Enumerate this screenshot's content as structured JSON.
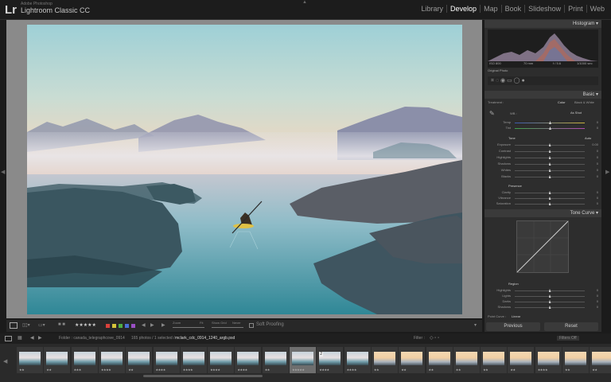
{
  "app": {
    "logo": "Lr",
    "vendor": "Adobe Photoshop",
    "product": "Lightroom Classic CC"
  },
  "modules": [
    "Library",
    "Develop",
    "Map",
    "Book",
    "Slideshow",
    "Print",
    "Web"
  ],
  "active_module": "Develop",
  "toolbar": {
    "zoom_label": "Zoom",
    "zoom_value": "Fit",
    "show_grid_label": "Show Grid",
    "show_grid_value": "Never",
    "soft_proofing": "Soft Proofing",
    "stars": "★★★★★"
  },
  "histogram": {
    "title": "Histogram",
    "iso": "ISO 800",
    "focal": "70 mm",
    "aperture": "f / 5.6",
    "shutter": "1/1000 sec",
    "original_label": "Original Photo"
  },
  "basic": {
    "title": "Basic",
    "treatment_label": "Treatment :",
    "color": "Color",
    "bw": "Black & White",
    "wb_label": "WB :",
    "wb_value": "As Shot",
    "temp": {
      "label": "Temp",
      "value": "0",
      "pos": 0.5
    },
    "tint": {
      "label": "Tint",
      "value": "0",
      "pos": 0.5
    },
    "tone_label": "Tone",
    "auto": "Auto",
    "tone": [
      {
        "label": "Exposure",
        "value": "0.00",
        "pos": 0.5
      },
      {
        "label": "Contrast",
        "value": "0",
        "pos": 0.5
      },
      {
        "label": "Highlights",
        "value": "0",
        "pos": 0.5
      },
      {
        "label": "Shadows",
        "value": "0",
        "pos": 0.5
      },
      {
        "label": "Whites",
        "value": "0",
        "pos": 0.5
      },
      {
        "label": "Blacks",
        "value": "0",
        "pos": 0.5
      }
    ],
    "presence_label": "Presence",
    "presence": [
      {
        "label": "Clarity",
        "value": "0",
        "pos": 0.5
      },
      {
        "label": "Vibrance",
        "value": "0",
        "pos": 0.5
      },
      {
        "label": "Saturation",
        "value": "0",
        "pos": 0.5
      }
    ]
  },
  "tone_curve": {
    "title": "Tone Curve",
    "region_label": "Region",
    "region": [
      {
        "label": "Highlights",
        "value": "0",
        "pos": 0.5
      },
      {
        "label": "Lights",
        "value": "0",
        "pos": 0.5
      },
      {
        "label": "Darks",
        "value": "0",
        "pos": 0.5
      },
      {
        "label": "Shadows",
        "value": "0",
        "pos": 0.5
      }
    ],
    "point_curve_label": "Point Curve :",
    "point_curve_value": "Linear"
  },
  "buttons": {
    "previous": "Previous",
    "reset": "Reset"
  },
  "filmstrip_bar": {
    "folder": "Folder : canada_telegraphcove_0914",
    "count": "165 photos / 1 selected /",
    "filename": "mclark_cdc_0914_1240_argb.psd",
    "filter_label": "Filter :",
    "filter_value": "Filters Off"
  },
  "filmstrip_thumbs": [
    {
      "stars": "★★",
      "tone": "mist"
    },
    {
      "stars": "★★",
      "tone": "mist"
    },
    {
      "stars": "★★★",
      "tone": "mist"
    },
    {
      "stars": "★★★★",
      "tone": "mist"
    },
    {
      "stars": "★★",
      "tone": "mist"
    },
    {
      "stars": "★★★★",
      "tone": "mist"
    },
    {
      "stars": "★★★★",
      "tone": "mist"
    },
    {
      "stars": "★★★★",
      "tone": "mist"
    },
    {
      "stars": "★★★★",
      "tone": "mist"
    },
    {
      "stars": "★★",
      "tone": "mist"
    },
    {
      "stars": "★★★★★",
      "tone": "mist",
      "selected": true
    },
    {
      "stars": "★★★★",
      "tone": "mist",
      "badge": "2"
    },
    {
      "stars": "★★★★",
      "tone": "mist"
    },
    {
      "stars": "★★",
      "tone": "warm"
    },
    {
      "stars": "★★",
      "tone": "warm"
    },
    {
      "stars": "★★",
      "tone": "warm"
    },
    {
      "stars": "★★",
      "tone": "warm"
    },
    {
      "stars": "★★",
      "tone": "warm"
    },
    {
      "stars": "★★",
      "tone": "warm"
    },
    {
      "stars": "★★★★",
      "tone": "warm"
    },
    {
      "stars": "★★",
      "tone": "warm"
    },
    {
      "stars": "★★",
      "tone": "warm"
    }
  ],
  "colors": {
    "accent": "#ffffff",
    "panel": "#2d2d2d",
    "active_thumb": "#6e6e6e"
  }
}
